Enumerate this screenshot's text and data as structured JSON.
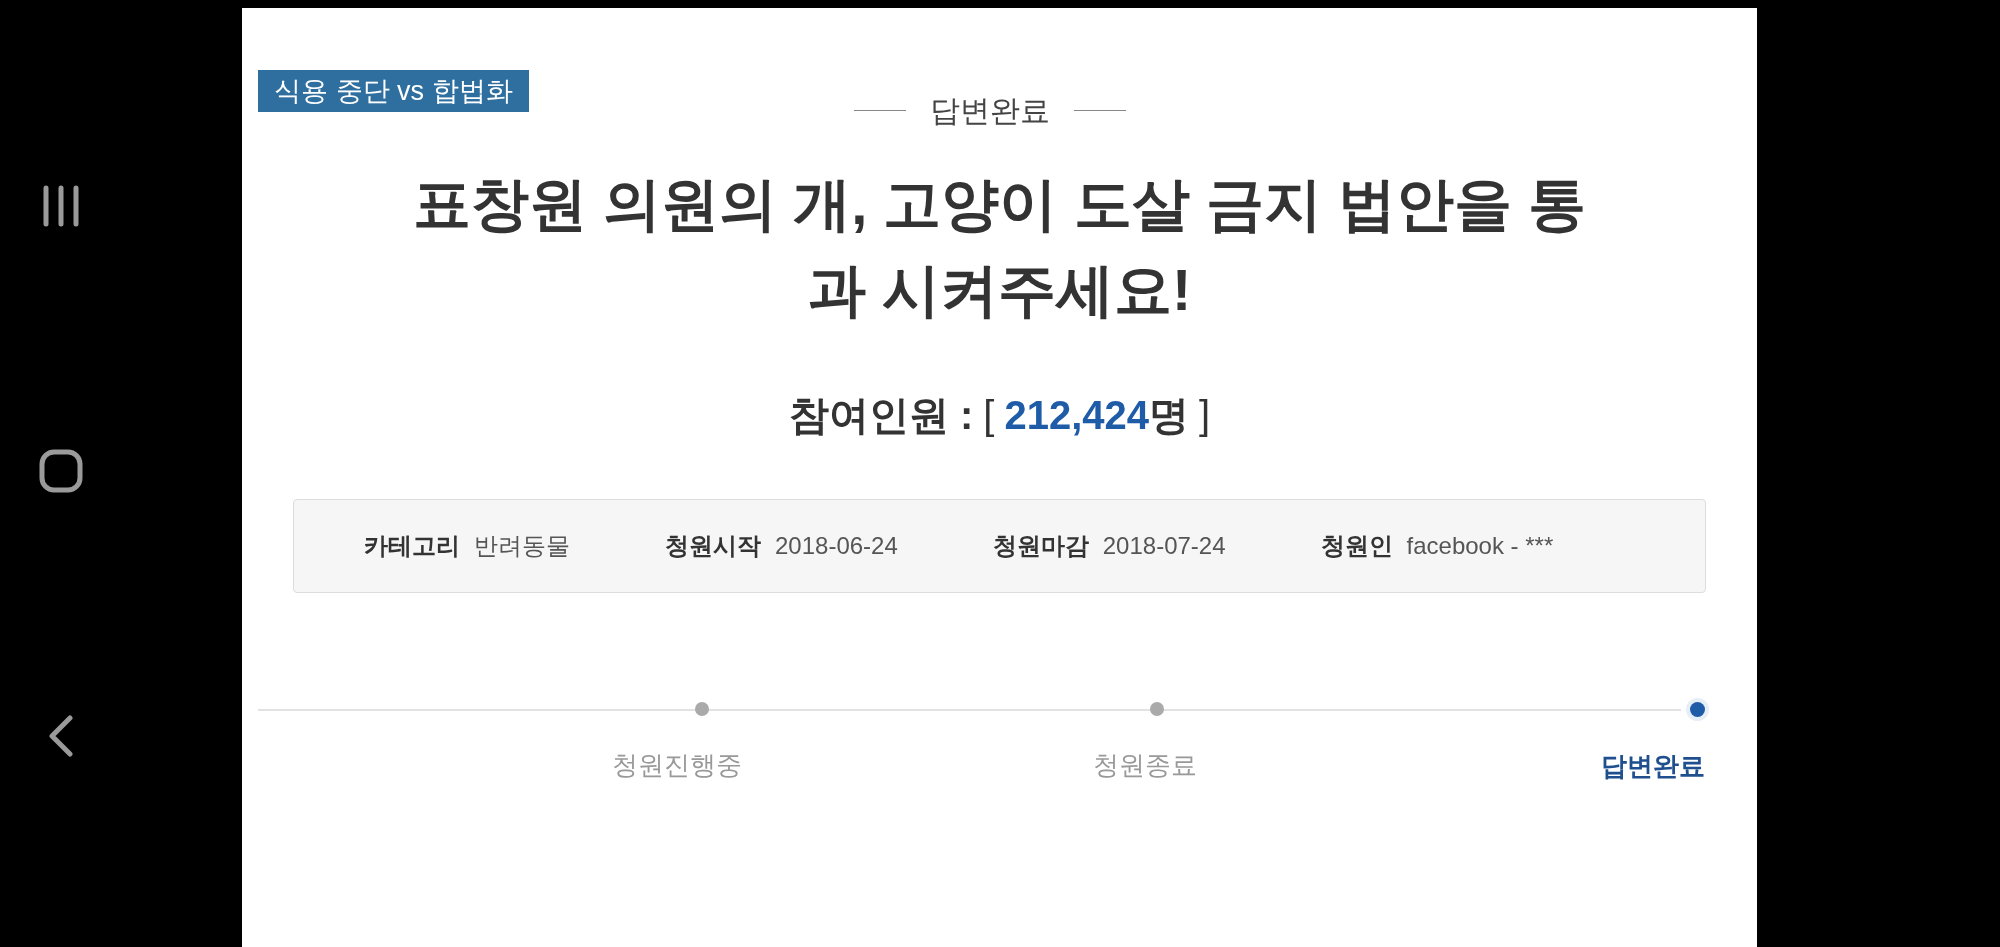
{
  "tag": "식용 중단 vs 합법화",
  "status": "답변완료",
  "title_lines": [
    "표창원 의원의 개, 고양이 도살 금지 법안을 통",
    "과 시켜주세요!"
  ],
  "participants": {
    "label": "참여인원 :",
    "open": "[",
    "count": "212,424",
    "unit": "명",
    "close": "]"
  },
  "info": [
    {
      "label": "카테고리",
      "value": "반려동물"
    },
    {
      "label": "청원시작",
      "value": "2018-06-24"
    },
    {
      "label": "청원마감",
      "value": "2018-07-24"
    },
    {
      "label": "청원인",
      "value": "facebook - ***"
    }
  ],
  "stages": [
    {
      "label": "청원진행중",
      "selected": false
    },
    {
      "label": "청원종료",
      "selected": false
    },
    {
      "label": "답변완료",
      "selected": true
    }
  ]
}
